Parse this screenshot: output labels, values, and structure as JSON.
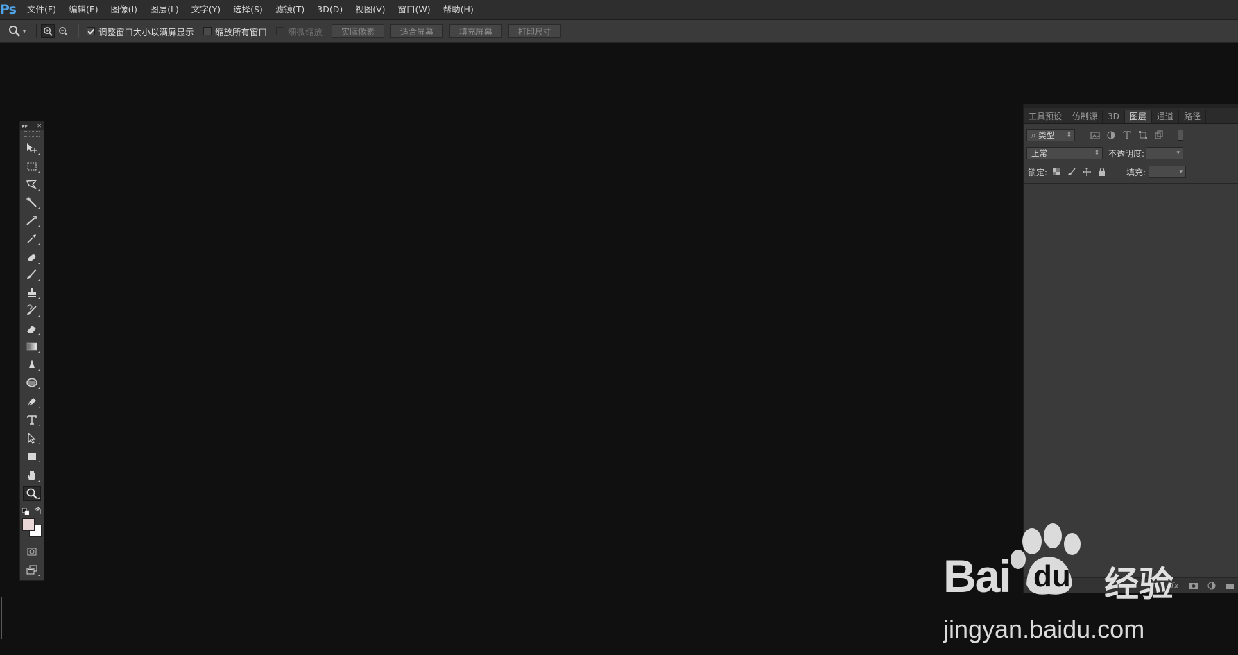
{
  "app": {
    "logo": "Ps"
  },
  "menu": [
    "文件(F)",
    "编辑(E)",
    "图像(I)",
    "图层(L)",
    "文字(Y)",
    "选择(S)",
    "滤镜(T)",
    "3D(D)",
    "视图(V)",
    "窗口(W)",
    "帮助(H)"
  ],
  "options": {
    "resize_windows": {
      "label": "调整窗口大小以满屏显示",
      "checked": true
    },
    "zoom_all": {
      "label": "缩放所有窗口",
      "checked": false
    },
    "scrubby_zoom": {
      "label": "细微缩放",
      "checked": false,
      "disabled": true
    },
    "buttons": [
      "实际像素",
      "适合屏幕",
      "填充屏幕",
      "打印尺寸"
    ]
  },
  "tools": [
    "move-icon",
    "marquee-icon",
    "lasso-icon",
    "magic-wand-icon",
    "crop-icon",
    "eyedropper-icon",
    "healing-brush-icon",
    "brush-icon",
    "clone-stamp-icon",
    "history-brush-icon",
    "eraser-icon",
    "gradient-icon",
    "blur-icon",
    "dodge-icon",
    "pen-icon",
    "type-icon",
    "path-selection-icon",
    "rectangle-icon",
    "hand-icon",
    "zoom-icon"
  ],
  "panel": {
    "tabs": [
      "工具预设",
      "仿制源",
      "3D",
      "图层",
      "通道",
      "路径"
    ],
    "active_tab": "图层",
    "filter_kind": "类型",
    "blend_mode": "正常",
    "opacity_label": "不透明度:",
    "lock_label": "锁定:",
    "fill_label": "填充:"
  },
  "watermark": {
    "brand": "Bai",
    "brand2": "du",
    "sub": "经验",
    "url": "jingyan.baidu.com"
  },
  "colors": {
    "accent": "#4fa3e6",
    "menubar": "#2e2e2e",
    "options": "#3a3a3a",
    "canvas": "#101010",
    "foreground": "#e9d7d7",
    "background": "#ffffff"
  }
}
